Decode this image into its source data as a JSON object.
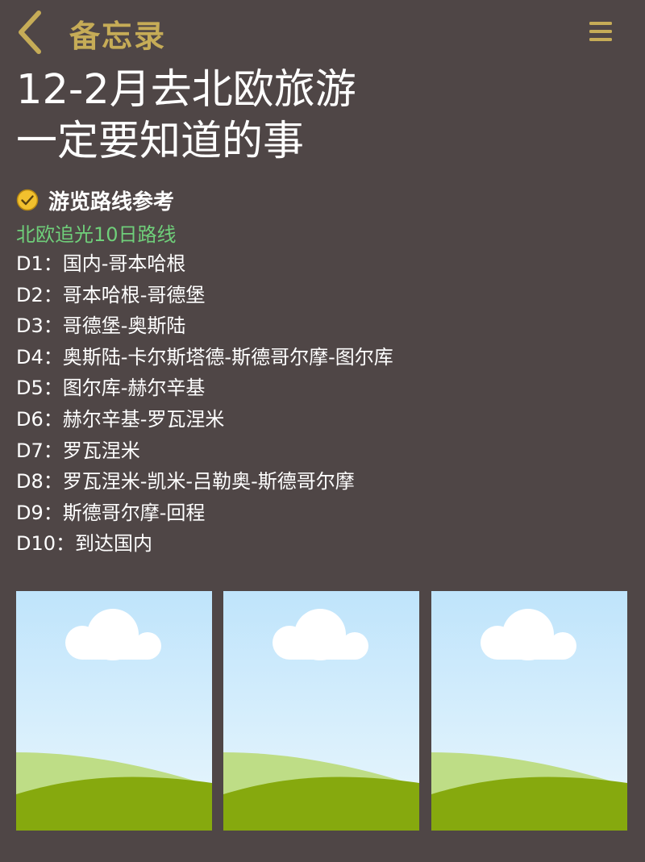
{
  "nav": {
    "title": "备忘录"
  },
  "note": {
    "title_lines": [
      "12-2月去北欧旅游",
      "一定要知道的事"
    ],
    "section": {
      "icon": "check-circle-icon",
      "title": "游览路线参考"
    },
    "route_title": "北欧追光10日路线",
    "itinerary": [
      "D1：国内-哥本哈根",
      "D2：哥本哈根-哥德堡",
      "D3：哥德堡-奥斯陆",
      "D4：奥斯陆-卡尔斯塔德-斯德哥尔摩-图尔库",
      "D5：图尔库-赫尔辛基",
      "D6：赫尔辛基-罗瓦涅米",
      "D7：罗瓦涅米",
      "D8：罗瓦涅米-凯米-吕勒奥-斯德哥尔摩",
      "D9：斯德哥尔摩-回程",
      "D10：到达国内"
    ]
  },
  "icons": {
    "back": "chevron-left-icon",
    "menu": "hamburger-menu-icon",
    "photo": "landscape-placeholder-icon"
  },
  "colors": {
    "background": "#4f4646",
    "accent": "#c6ac57",
    "route_green": "#6fcf7a",
    "text": "#ffffff"
  }
}
